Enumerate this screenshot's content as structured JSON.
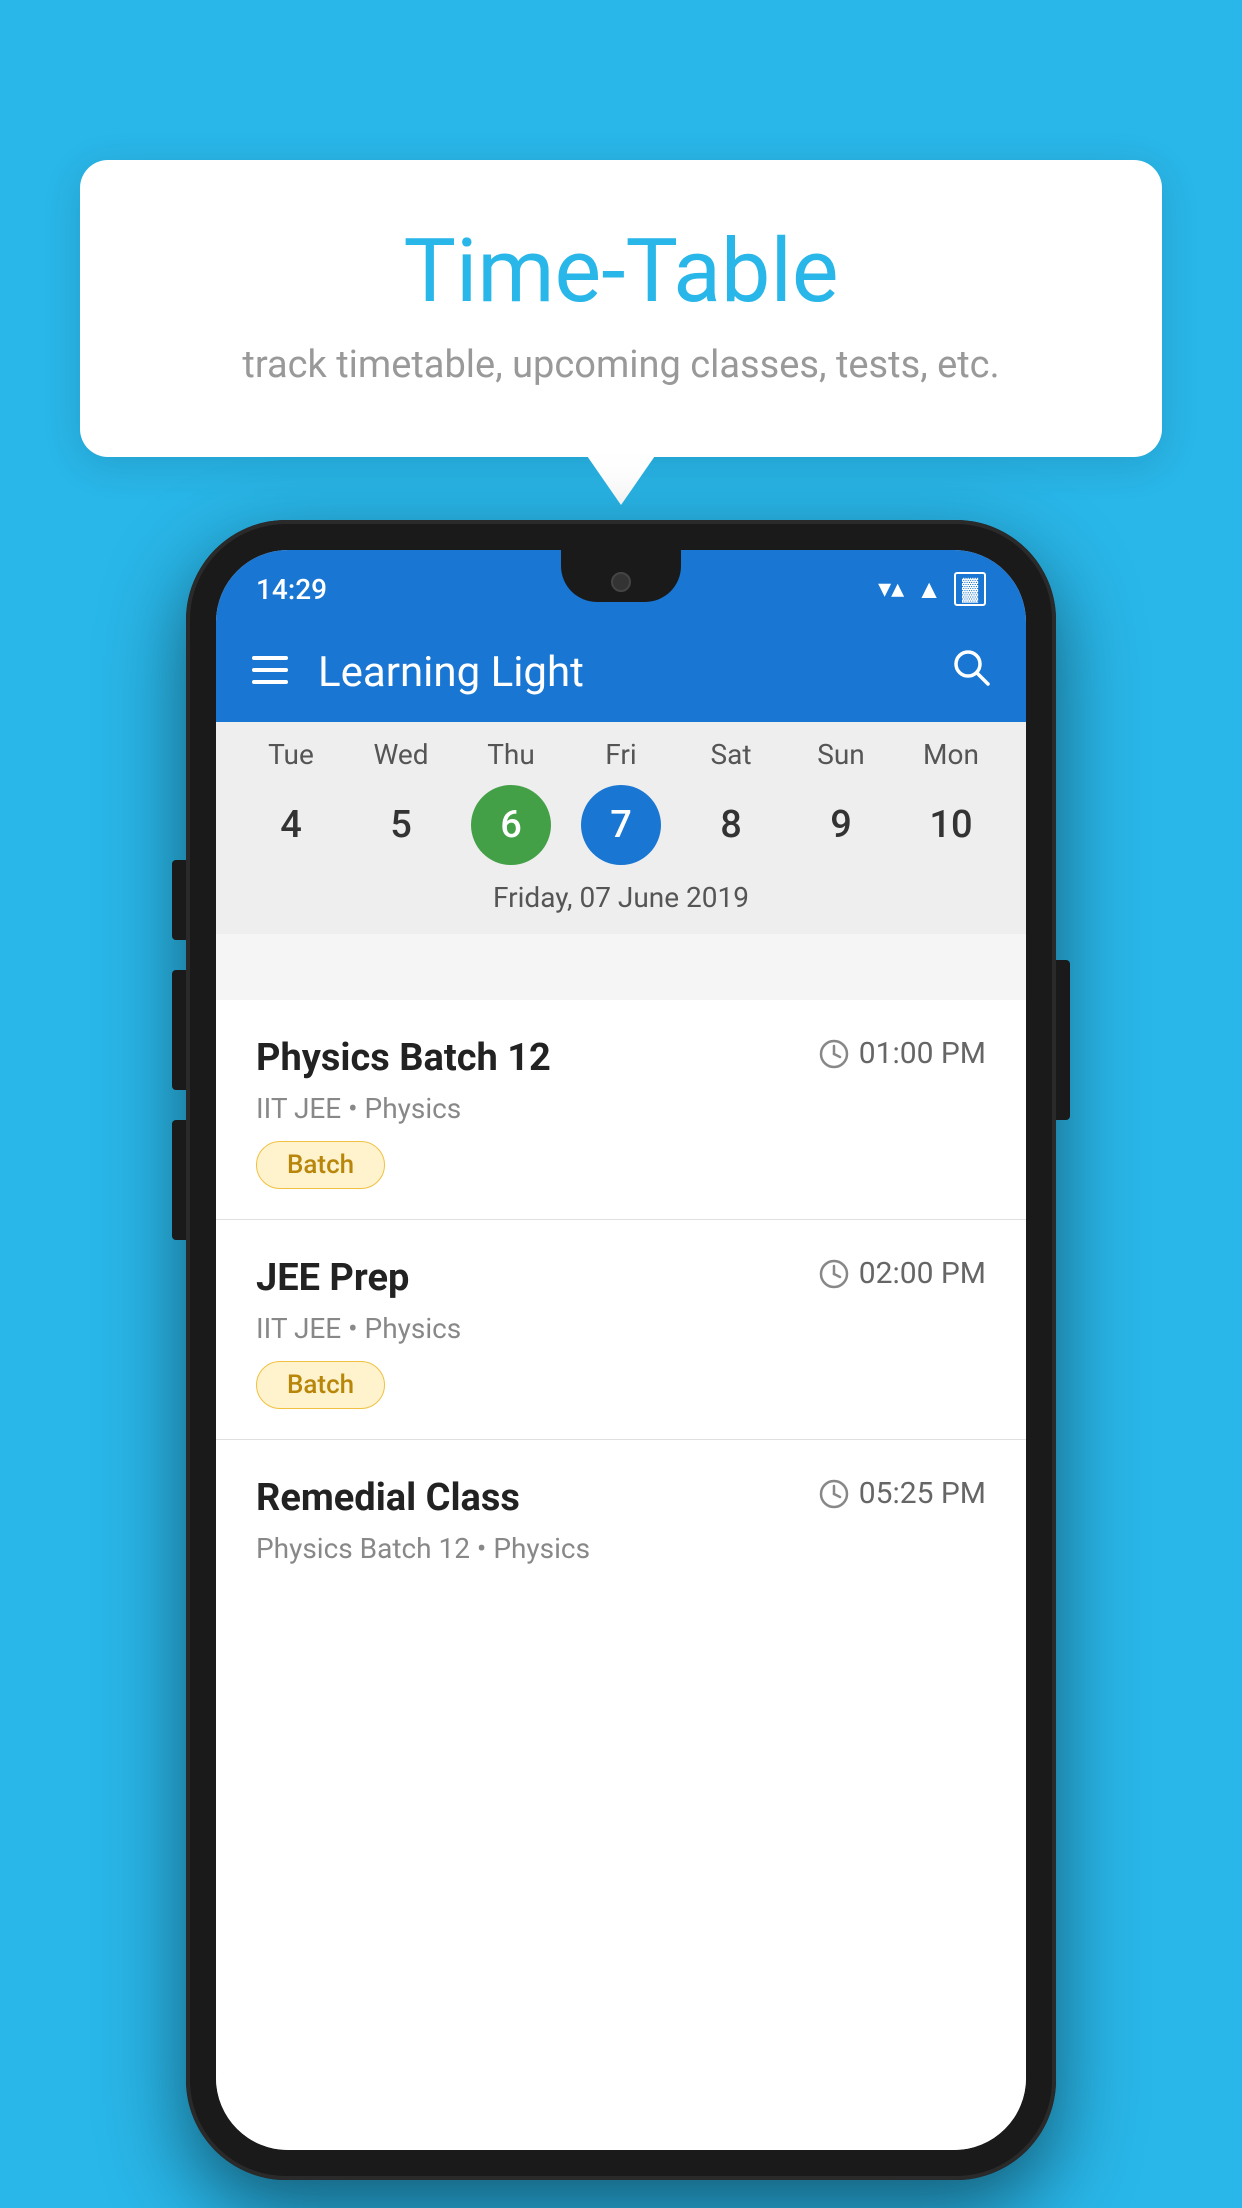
{
  "background": {
    "color": "#29b6e8"
  },
  "tooltip": {
    "title": "Time-Table",
    "subtitle": "track timetable, upcoming classes, tests, etc."
  },
  "phone": {
    "statusBar": {
      "time": "14:29"
    },
    "appBar": {
      "title": "Learning Light"
    },
    "calendar": {
      "days": [
        {
          "label": "Tue",
          "num": "4"
        },
        {
          "label": "Wed",
          "num": "5"
        },
        {
          "label": "Thu",
          "num": "6",
          "state": "today"
        },
        {
          "label": "Fri",
          "num": "7",
          "state": "selected"
        },
        {
          "label": "Sat",
          "num": "8"
        },
        {
          "label": "Sun",
          "num": "9"
        },
        {
          "label": "Mon",
          "num": "10"
        }
      ],
      "selectedDateLabel": "Friday, 07 June 2019"
    },
    "events": [
      {
        "name": "Physics Batch 12",
        "time": "01:00 PM",
        "meta": "IIT JEE • Physics",
        "badge": "Batch"
      },
      {
        "name": "JEE Prep",
        "time": "02:00 PM",
        "meta": "IIT JEE • Physics",
        "badge": "Batch"
      },
      {
        "name": "Remedial Class",
        "time": "05:25 PM",
        "meta": "Physics Batch 12 • Physics",
        "badge": ""
      }
    ],
    "icons": {
      "menu": "☰",
      "search": "🔍",
      "clock": "🕐"
    }
  }
}
